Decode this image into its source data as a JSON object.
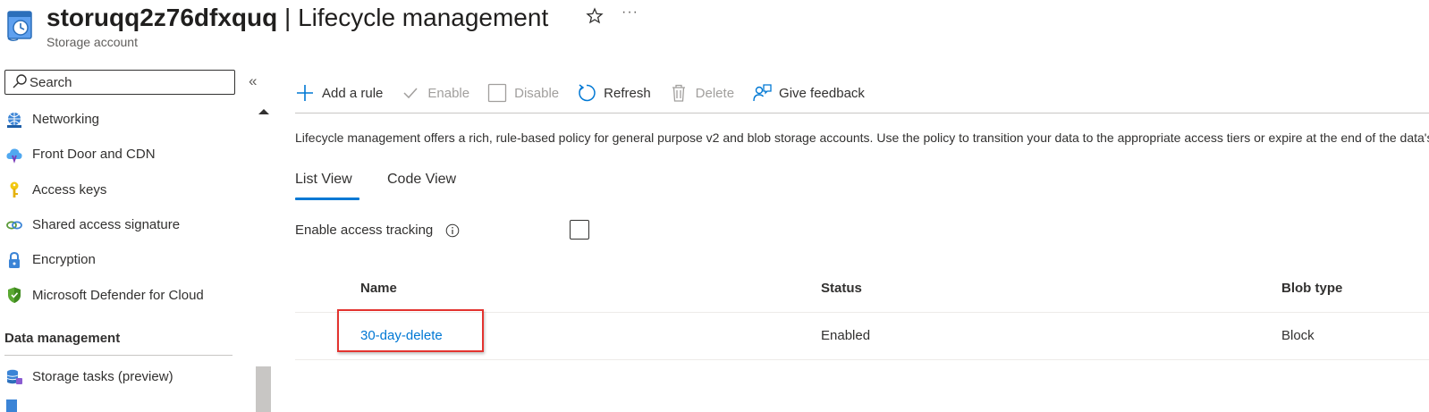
{
  "header": {
    "resource_name": "storuqq2z76dfxquq",
    "separator": " | ",
    "page_name": "Lifecycle management",
    "subtitle": "Storage account",
    "favorite_icon": "star-icon",
    "more_icon": "ellipsis-icon",
    "more_label": "···"
  },
  "sidebar": {
    "search_placeholder": "Search",
    "collapse_label": "«",
    "items": [
      {
        "label": "Networking",
        "icon": "networking-icon"
      },
      {
        "label": "Front Door and CDN",
        "icon": "cloud-icon"
      },
      {
        "label": "Access keys",
        "icon": "key-icon"
      },
      {
        "label": "Shared access signature",
        "icon": "link-chain-icon"
      },
      {
        "label": "Encryption",
        "icon": "lock-icon"
      },
      {
        "label": "Microsoft Defender for Cloud",
        "icon": "shield-icon"
      }
    ],
    "section_title": "Data management",
    "section_items": [
      {
        "label": "Storage tasks (preview)",
        "icon": "storage-tasks-icon"
      }
    ]
  },
  "toolbar": {
    "add_rule": "Add a rule",
    "enable": "Enable",
    "disable": "Disable",
    "refresh": "Refresh",
    "delete": "Delete",
    "feedback": "Give feedback"
  },
  "description": "Lifecycle management offers a rich, rule-based policy for general purpose v2 and blob storage accounts. Use the policy to transition your data to the appropriate access tiers or expire at the end of the data's lifecycle.",
  "tabs": {
    "list_view": "List View",
    "code_view": "Code View",
    "selected": "List View"
  },
  "access_tracking": {
    "label": "Enable access tracking",
    "checked": false,
    "info_icon": "info-icon"
  },
  "table": {
    "columns": [
      "Name",
      "Status",
      "Blob type"
    ],
    "rows": [
      {
        "name": "30-day-delete",
        "status": "Enabled",
        "blob_type": "Block"
      }
    ]
  },
  "colors": {
    "accent": "#0078d4",
    "highlight": "#e3332f",
    "text": "#323130",
    "disabled": "#a19f9d"
  }
}
